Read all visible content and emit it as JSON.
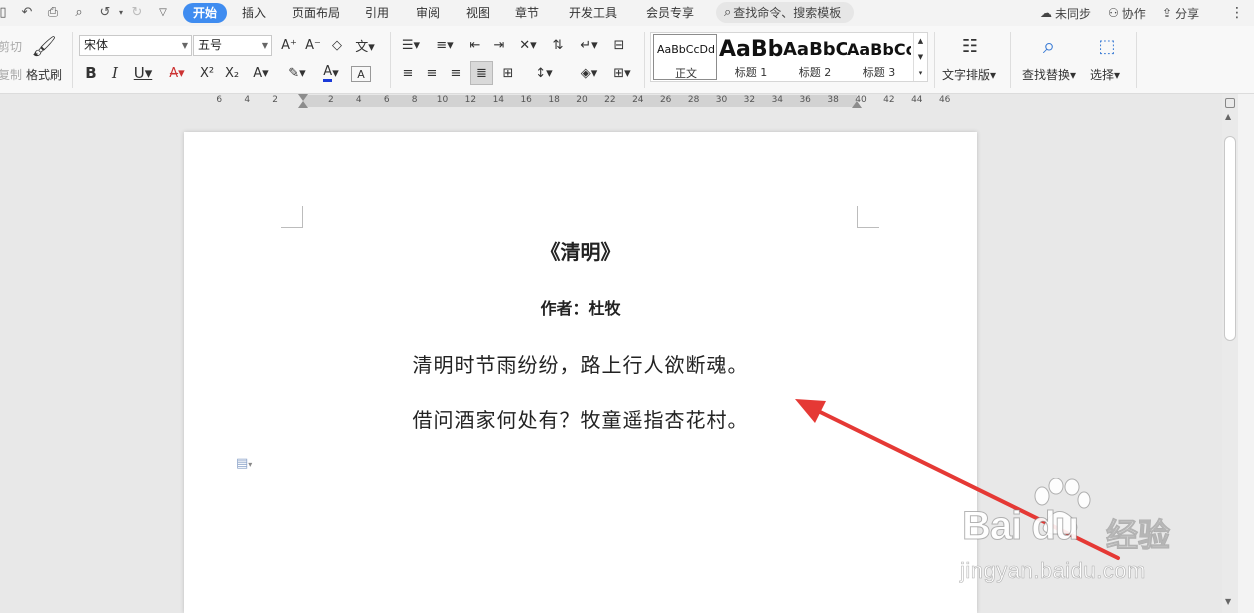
{
  "tabs": {
    "start": "开始",
    "insert": "插入",
    "layout": "页面布局",
    "references": "引用",
    "review": "审阅",
    "view": "视图",
    "chapter": "章节",
    "developer": "开发工具",
    "member": "会员专享"
  },
  "search": {
    "placeholder": "查找命令、搜索模板"
  },
  "top_right": {
    "sync": "未同步",
    "collab": "协作",
    "share": "分享"
  },
  "clipboard": {
    "cut": "剪切",
    "copy": "复制",
    "format_painter": "格式刷"
  },
  "font": {
    "name": "宋体",
    "size": "五号"
  },
  "styles": {
    "normal_preview": "AaBbCcDd",
    "normal": "正文",
    "h1_preview": "AaBb",
    "h1": "标题 1",
    "h2_preview": "AaBbC",
    "h2": "标题 2",
    "h3_preview": "AaBbCc",
    "h3": "标题 3"
  },
  "tools": {
    "text_layout": "文字排版",
    "find_replace": "查找替换",
    "select": "选择"
  },
  "ruler": {
    "left_ticks": [
      "6",
      "4",
      "2"
    ],
    "right_ticks": [
      "2",
      "4",
      "6",
      "8",
      "10",
      "12",
      "14",
      "16",
      "18",
      "20",
      "22",
      "24",
      "26",
      "28",
      "30",
      "32",
      "34",
      "36",
      "38",
      "40",
      "42",
      "44",
      "46"
    ]
  },
  "document": {
    "title": "《清明》",
    "author": "作者：杜牧",
    "line1": "清明时节雨纷纷，路上行人欲断魂。",
    "line2": "借问酒家何处有？牧童遥指杏花村。"
  },
  "watermark": {
    "brand": "Bai du",
    "brand_cn": "经验",
    "url": "jingyan.baidu.com"
  },
  "colors": {
    "accent": "#3f8cf0",
    "annotation_arrow": "#e53935"
  }
}
